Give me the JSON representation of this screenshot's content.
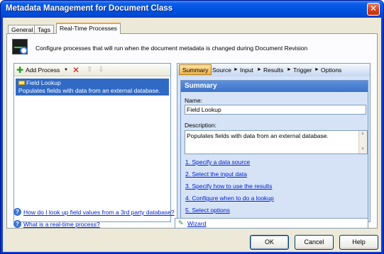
{
  "window": {
    "title": "Metadata Management for Document Class",
    "close_label": "✕"
  },
  "tabs": [
    {
      "label": "General"
    },
    {
      "label": "Tags"
    },
    {
      "label": "Real-Time Processes"
    }
  ],
  "header": {
    "description": "Configure processes that will run when the document metadata is changed during Document Revision"
  },
  "left_toolbar": {
    "add_label": "Add Process",
    "dropdown_glyph": "▼",
    "delete_glyph": "✕",
    "up_glyph": "⇧",
    "down_glyph": "⇩"
  },
  "processes": [
    {
      "title": "Field Lookup",
      "description": "Populates fields with data from an external database."
    }
  ],
  "wizard_steps": [
    {
      "label": "Summary"
    },
    {
      "label": "Source"
    },
    {
      "label": "Input"
    },
    {
      "label": "Results"
    },
    {
      "label": "Trigger"
    },
    {
      "label": "Options"
    }
  ],
  "summary": {
    "heading": "Summary",
    "name_label": "Name:",
    "name_value": "Field Lookup",
    "description_label": "Description:",
    "description_value": "Populates fields with data from an external database.",
    "steps": [
      "1. Specify a data source",
      "2. Select the input data",
      "3. Specify how to use the results",
      "4. Configure when to do a lookup",
      "5. Select options"
    ]
  },
  "wizard_link": "Wizard",
  "help_links": [
    "How do I look up field values from a 3rd party database?",
    "What is a real-time process?"
  ],
  "buttons": {
    "ok": "OK",
    "cancel": "Cancel",
    "help": "Help"
  },
  "colors": {
    "title_bar": "#0054e3",
    "selection": "#316ac5",
    "link": "#0022cc",
    "active_step": "#f3b24c"
  }
}
